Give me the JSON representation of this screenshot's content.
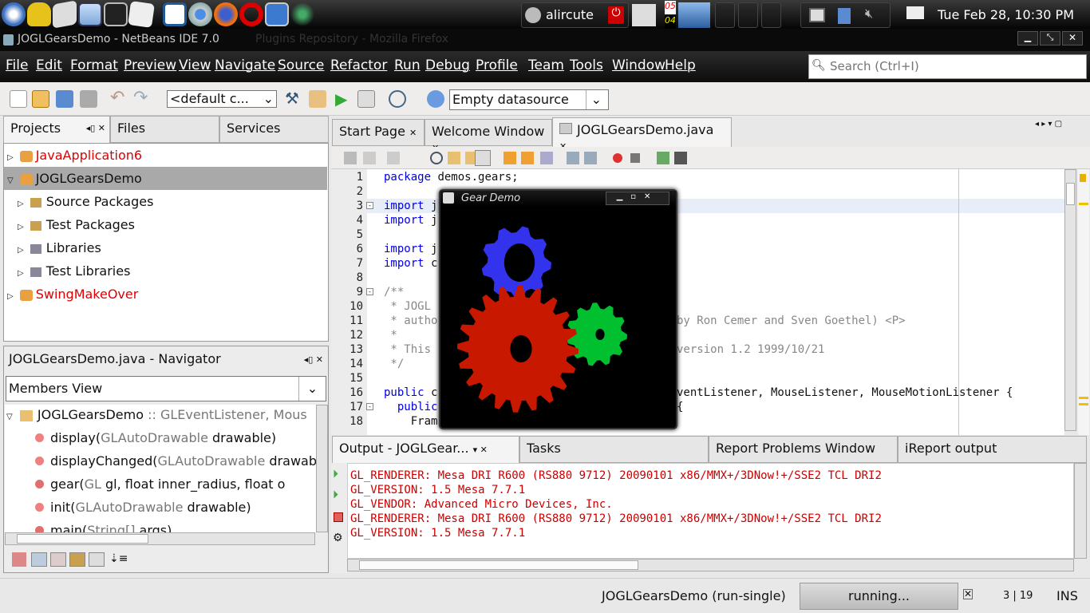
{
  "top_panel": {
    "launchers": [
      "media-player-icon",
      "teapot-icon",
      "book-icon",
      "netbeans-icon",
      "terminal-icon",
      "text-editor-icon",
      "writer-icon",
      "chromium-icon",
      "firefox-icon",
      "opera-icon",
      "network-icon",
      "plant-icon"
    ],
    "user": "alircute",
    "cpu_top": "05",
    "cpu_bottom": "04",
    "clock": "Tue Feb 28, 10:30 PM"
  },
  "window": {
    "title": "JOGLGearsDemo - NetBeans IDE 7.0",
    "ghost_title": "Plugins Repository - Mozilla Firefox"
  },
  "menu": [
    "File",
    "Edit",
    "Format",
    "Preview",
    "View",
    "Navigate",
    "Source",
    "Refactor",
    "Run",
    "Debug",
    "Profile",
    "Team",
    "Tools",
    "Window",
    "Help"
  ],
  "search": {
    "placeholder": "Search (Ctrl+I)"
  },
  "toolbar": {
    "config": "<default c...",
    "datasource": "Empty datasource"
  },
  "projects": {
    "tabs": [
      "Projects",
      "Files",
      "Services"
    ],
    "items": [
      {
        "label": "JavaApplication6",
        "color": "#e00000",
        "level": 0,
        "expanded": false
      },
      {
        "label": "JOGLGearsDemo",
        "color": "#111",
        "level": 0,
        "expanded": true,
        "selected": true
      },
      {
        "label": "Source Packages",
        "level": 1
      },
      {
        "label": "Test Packages",
        "level": 1
      },
      {
        "label": "Libraries",
        "level": 1
      },
      {
        "label": "Test Libraries",
        "level": 1
      },
      {
        "label": "SwingMakeOver",
        "color": "#e00000",
        "level": 0
      }
    ]
  },
  "navigator": {
    "title": "JOGLGearsDemo.java - Navigator",
    "view": "Members View",
    "root": "JOGLGearsDemo",
    "root_suffix": ":: GLEventListener, Mous",
    "members": [
      {
        "name": "display(",
        "type": "GLAutoDrawable",
        "rest": " drawable)"
      },
      {
        "name": "displayChanged(",
        "type": "GLAutoDrawable",
        "rest": " drawabl"
      },
      {
        "name": "gear(",
        "type": "GL",
        "rest": " gl, float inner_radius, float o"
      },
      {
        "name": "init(",
        "type": "GLAutoDrawable",
        "rest": " drawable)"
      },
      {
        "name": "main(",
        "type": "String[]",
        "rest": " args)"
      }
    ]
  },
  "editor": {
    "tabs": [
      "Start Page",
      "Welcome Window",
      "JOGLGearsDemo.java"
    ],
    "lines": [
      {
        "n": "1",
        "kw": "package",
        "text": " demos.gears;"
      },
      {
        "n": "2"
      },
      {
        "n": "3",
        "kw": "import",
        "text": " j"
      },
      {
        "n": "4",
        "kw": "import",
        "text": " j"
      },
      {
        "n": "5"
      },
      {
        "n": "6",
        "kw": "import",
        "text": " j"
      },
      {
        "n": "7",
        "kw": "import",
        "text": " c"
      },
      {
        "n": "8"
      },
      {
        "n": "9",
        "cm": "/**"
      },
      {
        "n": "10",
        "cm": " * JOGL"
      },
      {
        "n": "11",
        "cm": " * autho",
        "right": "by Ron Cemer and Sven Goethel) <P>"
      },
      {
        "n": "12",
        "cm": " *"
      },
      {
        "n": "13",
        "cm": " * This",
        "right": "version 1.2 1999/10/21"
      },
      {
        "n": "14",
        "cm": " */"
      },
      {
        "n": "15"
      },
      {
        "n": "16",
        "kw": "public",
        "text": " c",
        "right_plain": "ventListener, MouseListener, MouseMotionListener {"
      },
      {
        "n": "17",
        "kw": "  public",
        "text": "",
        "right_plain": "{"
      },
      {
        "n": "18",
        "text": "    Fram"
      }
    ]
  },
  "gear_demo": {
    "title": "Gear Demo",
    "colors": {
      "blue": "#3333ee",
      "red": "#c81800",
      "green": "#00c030"
    }
  },
  "output": {
    "tabs": [
      "Output - JOGLGear...",
      "Tasks",
      "Report Problems Window",
      "iReport output"
    ],
    "lines": [
      "GL_RENDERER: Mesa DRI R600 (RS880 9712) 20090101 x86/MMX+/3DNow!+/SSE2 TCL DRI2",
      "GL_VERSION: 1.5 Mesa 7.7.1",
      "GL_VENDOR: Advanced Micro Devices, Inc.",
      "GL_RENDERER: Mesa DRI R600 (RS880 9712) 20090101 x86/MMX+/3DNow!+/SSE2 TCL DRI2",
      "GL_VERSION: 1.5 Mesa 7.7.1"
    ]
  },
  "status": {
    "task": "JOGLGearsDemo (run-single)",
    "progress": "running...",
    "position": "3 | 19",
    "mode": "INS"
  }
}
